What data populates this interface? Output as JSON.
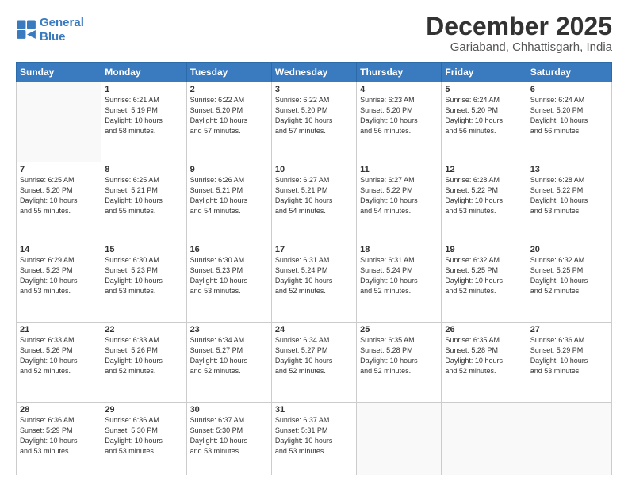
{
  "logo": {
    "line1": "General",
    "line2": "Blue"
  },
  "title": "December 2025",
  "location": "Gariaband, Chhattisgarh, India",
  "headers": [
    "Sunday",
    "Monday",
    "Tuesday",
    "Wednesday",
    "Thursday",
    "Friday",
    "Saturday"
  ],
  "weeks": [
    [
      {
        "day": "",
        "info": ""
      },
      {
        "day": "1",
        "info": "Sunrise: 6:21 AM\nSunset: 5:19 PM\nDaylight: 10 hours\nand 58 minutes."
      },
      {
        "day": "2",
        "info": "Sunrise: 6:22 AM\nSunset: 5:20 PM\nDaylight: 10 hours\nand 57 minutes."
      },
      {
        "day": "3",
        "info": "Sunrise: 6:22 AM\nSunset: 5:20 PM\nDaylight: 10 hours\nand 57 minutes."
      },
      {
        "day": "4",
        "info": "Sunrise: 6:23 AM\nSunset: 5:20 PM\nDaylight: 10 hours\nand 56 minutes."
      },
      {
        "day": "5",
        "info": "Sunrise: 6:24 AM\nSunset: 5:20 PM\nDaylight: 10 hours\nand 56 minutes."
      },
      {
        "day": "6",
        "info": "Sunrise: 6:24 AM\nSunset: 5:20 PM\nDaylight: 10 hours\nand 56 minutes."
      }
    ],
    [
      {
        "day": "7",
        "info": "Sunrise: 6:25 AM\nSunset: 5:20 PM\nDaylight: 10 hours\nand 55 minutes."
      },
      {
        "day": "8",
        "info": "Sunrise: 6:25 AM\nSunset: 5:21 PM\nDaylight: 10 hours\nand 55 minutes."
      },
      {
        "day": "9",
        "info": "Sunrise: 6:26 AM\nSunset: 5:21 PM\nDaylight: 10 hours\nand 54 minutes."
      },
      {
        "day": "10",
        "info": "Sunrise: 6:27 AM\nSunset: 5:21 PM\nDaylight: 10 hours\nand 54 minutes."
      },
      {
        "day": "11",
        "info": "Sunrise: 6:27 AM\nSunset: 5:22 PM\nDaylight: 10 hours\nand 54 minutes."
      },
      {
        "day": "12",
        "info": "Sunrise: 6:28 AM\nSunset: 5:22 PM\nDaylight: 10 hours\nand 53 minutes."
      },
      {
        "day": "13",
        "info": "Sunrise: 6:28 AM\nSunset: 5:22 PM\nDaylight: 10 hours\nand 53 minutes."
      }
    ],
    [
      {
        "day": "14",
        "info": "Sunrise: 6:29 AM\nSunset: 5:23 PM\nDaylight: 10 hours\nand 53 minutes."
      },
      {
        "day": "15",
        "info": "Sunrise: 6:30 AM\nSunset: 5:23 PM\nDaylight: 10 hours\nand 53 minutes."
      },
      {
        "day": "16",
        "info": "Sunrise: 6:30 AM\nSunset: 5:23 PM\nDaylight: 10 hours\nand 53 minutes."
      },
      {
        "day": "17",
        "info": "Sunrise: 6:31 AM\nSunset: 5:24 PM\nDaylight: 10 hours\nand 52 minutes."
      },
      {
        "day": "18",
        "info": "Sunrise: 6:31 AM\nSunset: 5:24 PM\nDaylight: 10 hours\nand 52 minutes."
      },
      {
        "day": "19",
        "info": "Sunrise: 6:32 AM\nSunset: 5:25 PM\nDaylight: 10 hours\nand 52 minutes."
      },
      {
        "day": "20",
        "info": "Sunrise: 6:32 AM\nSunset: 5:25 PM\nDaylight: 10 hours\nand 52 minutes."
      }
    ],
    [
      {
        "day": "21",
        "info": "Sunrise: 6:33 AM\nSunset: 5:26 PM\nDaylight: 10 hours\nand 52 minutes."
      },
      {
        "day": "22",
        "info": "Sunrise: 6:33 AM\nSunset: 5:26 PM\nDaylight: 10 hours\nand 52 minutes."
      },
      {
        "day": "23",
        "info": "Sunrise: 6:34 AM\nSunset: 5:27 PM\nDaylight: 10 hours\nand 52 minutes."
      },
      {
        "day": "24",
        "info": "Sunrise: 6:34 AM\nSunset: 5:27 PM\nDaylight: 10 hours\nand 52 minutes."
      },
      {
        "day": "25",
        "info": "Sunrise: 6:35 AM\nSunset: 5:28 PM\nDaylight: 10 hours\nand 52 minutes."
      },
      {
        "day": "26",
        "info": "Sunrise: 6:35 AM\nSunset: 5:28 PM\nDaylight: 10 hours\nand 52 minutes."
      },
      {
        "day": "27",
        "info": "Sunrise: 6:36 AM\nSunset: 5:29 PM\nDaylight: 10 hours\nand 53 minutes."
      }
    ],
    [
      {
        "day": "28",
        "info": "Sunrise: 6:36 AM\nSunset: 5:29 PM\nDaylight: 10 hours\nand 53 minutes."
      },
      {
        "day": "29",
        "info": "Sunrise: 6:36 AM\nSunset: 5:30 PM\nDaylight: 10 hours\nand 53 minutes."
      },
      {
        "day": "30",
        "info": "Sunrise: 6:37 AM\nSunset: 5:30 PM\nDaylight: 10 hours\nand 53 minutes."
      },
      {
        "day": "31",
        "info": "Sunrise: 6:37 AM\nSunset: 5:31 PM\nDaylight: 10 hours\nand 53 minutes."
      },
      {
        "day": "",
        "info": ""
      },
      {
        "day": "",
        "info": ""
      },
      {
        "day": "",
        "info": ""
      }
    ]
  ]
}
